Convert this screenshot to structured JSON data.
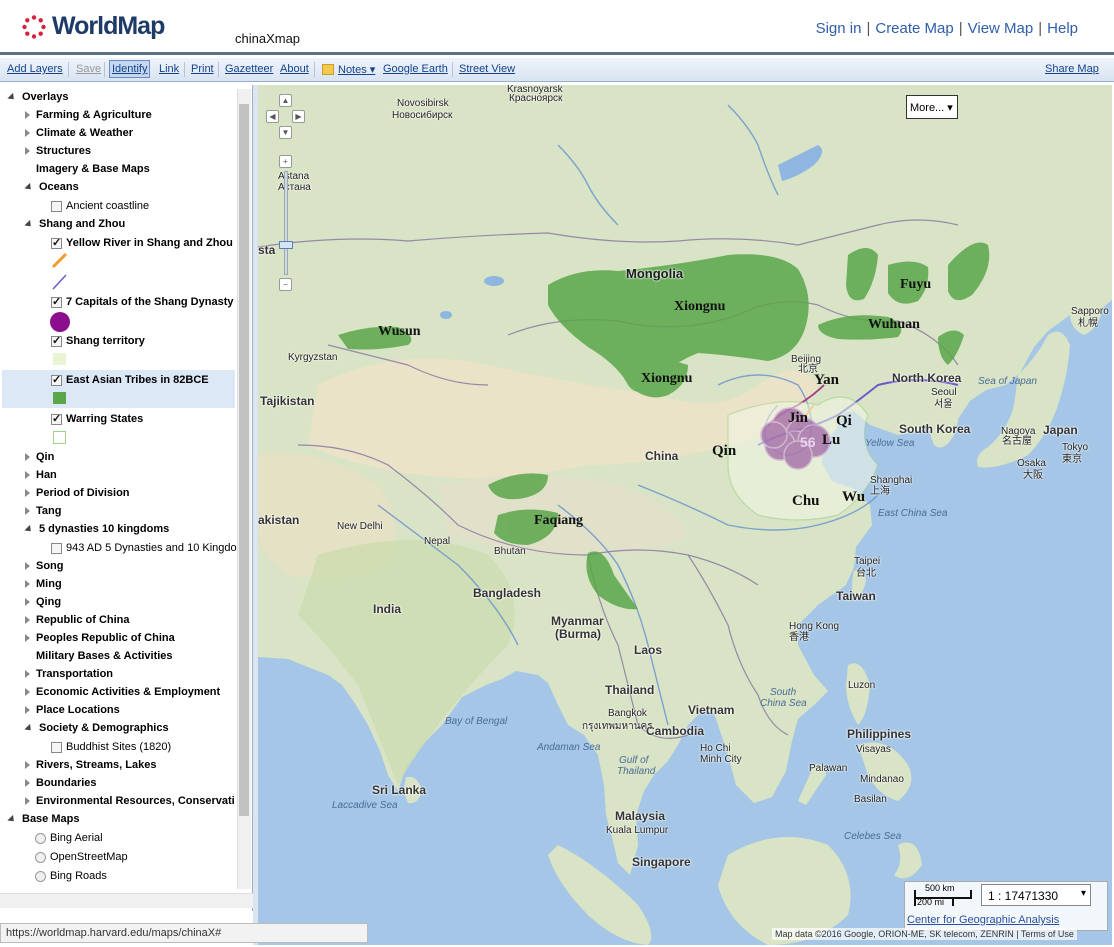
{
  "header": {
    "logo_text": "WorldMap",
    "map_title": "chinaXmap",
    "nav": [
      "Sign in",
      "Create Map",
      "View Map",
      "Help"
    ]
  },
  "toolbar": {
    "add_layers": "Add Layers",
    "save": "Save",
    "identify": "Identify",
    "link": "Link",
    "print": "Print",
    "gazetteer": "Gazetteer",
    "about": "About",
    "notes": "Notes",
    "google_earth": "Google Earth",
    "street_view": "Street View",
    "share_map": "Share Map"
  },
  "tree": {
    "overlays": "Overlays",
    "farming": "Farming & Agriculture",
    "climate": "Climate & Weather",
    "structures": "Structures",
    "imagery": "Imagery & Base Maps",
    "oceans": "Oceans",
    "ancient_coastline": "Ancient coastline",
    "shang_zhou": "Shang and Zhou",
    "yellow_river": "Yellow River in Shang and Zhou",
    "capitals": "7 Capitals of the Shang Dynasty",
    "shang_territory": "Shang territory",
    "tribes": "East Asian Tribes in 82BCE",
    "warring": "Warring States",
    "qin": "Qin",
    "han": "Han",
    "division": "Period of Division",
    "tang": "Tang",
    "five_dynasties": "5 dynasties 10 kingdoms",
    "five_dyn_layer": "943 AD 5 Dynasties and 10 Kingdo",
    "song": "Song",
    "ming": "Ming",
    "qing": "Qing",
    "roc": "Republic of China",
    "prc": "Peoples Republic of China",
    "military": "Military Bases & Activities",
    "transport": "Transportation",
    "economic": "Economic Activities & Employment",
    "places": "Place Locations",
    "society": "Society & Demographics",
    "buddhist": "Buddhist Sites (1820)",
    "rivers": "Rivers, Streams, Lakes",
    "boundaries": "Boundaries",
    "environment": "Environmental Resources, Conservati",
    "base_maps": "Base Maps",
    "bing_aerial": "Bing Aerial",
    "osm": "OpenStreetMap",
    "bing_roads": "Bing Roads"
  },
  "map": {
    "more_button": "More...",
    "tribes": [
      "Mongolia",
      "Xiongnu",
      "Xiongnu",
      "Wusun",
      "Wuhuan",
      "Fuyu",
      "Yan",
      "Jin",
      "Qi",
      "Lu",
      "Qin",
      "Chu",
      "Wu",
      "Faqiang"
    ],
    "countries": [
      "China",
      "India",
      "Tajikistan",
      "Nepal",
      "Bhutan",
      "Bangladesh",
      "Myanmar",
      "(Burma)",
      "Laos",
      "Thailand",
      "Vietnam",
      "Cambodia",
      "Malaysia",
      "Singapore",
      "Sri Lanka",
      "Philippines",
      "Taiwan",
      "North Korea",
      "South Korea",
      "Japan",
      "akistan",
      "sta"
    ],
    "cities": [
      "Novosibirsk",
      "Новосибирск",
      "Krasnoyarsk",
      "Красноярск",
      "Astana",
      "Астана",
      "Kyrgyzstan",
      "New Delhi",
      "Beijing",
      "北京",
      "Seoul",
      "서울",
      "Shanghai",
      "上海",
      "Taipei",
      "台北",
      "Hong Kong",
      "香港",
      "Bangkok",
      "กรุงเทพมหานคร",
      "Ho Chi",
      "Minh City",
      "Kuala Lumpur",
      "Nagoya",
      "名古屋",
      "Osaka",
      "大阪",
      "Tokyo",
      "東京",
      "Sapporo",
      "札幌",
      "Luzon",
      "Visayas",
      "Mindanao",
      "Palawan",
      "Basilan"
    ],
    "seas": [
      "Sea of Japan",
      "Yellow Sea",
      "East China Sea",
      "South",
      "China Sea",
      "Bay of Bengal",
      "Andaman Sea",
      "Gulf of",
      "Thailand",
      "Laccadive Sea",
      "Celebes Sea"
    ],
    "capital_label": "56",
    "scale_km": "500 km",
    "scale_mi": "200 mi",
    "scale_value": "1 : 17471330",
    "cga_link": "Center for Geographic Analysis",
    "attribution": "Map data ©2016 Google, ORION-ME, SK telecom, ZENRIN",
    "terms": "Terms of Use"
  },
  "status_url": "https://worldmap.harvard.edu/maps/chinaX#",
  "colors": {
    "tribe_green": "#5aa64a",
    "capital_purple": "#9b5ba0",
    "yellow_river_line": "#f59a2b",
    "zhou_line": "#6a5acd",
    "land": "#d8e4c4",
    "water": "#a5c6e6"
  }
}
